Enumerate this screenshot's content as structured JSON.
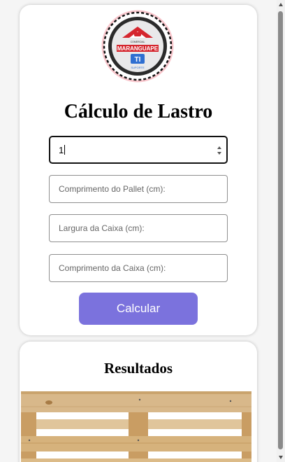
{
  "logo": {
    "top_text": "COMERCIAL",
    "brand": "MARANGUAPE",
    "sub_text": "SUPORTE",
    "colors": {
      "ring": "#222222",
      "red": "#d5262e",
      "blue": "#2f6fd1",
      "glow": "#f05a6a"
    }
  },
  "form": {
    "title": "Cálculo de Lastro",
    "quantity_value": "1",
    "pallet_length_placeholder": "Comprimento do Pallet (cm):",
    "box_width_placeholder": "Largura da Caixa (cm):",
    "box_length_placeholder": "Comprimento da Caixa (cm):",
    "submit_label": "Calcular"
  },
  "results": {
    "title": "Resultados",
    "image": "wooden-pallet"
  },
  "theme": {
    "accent": "#7b72dd",
    "card_bg": "#ffffff",
    "page_bg": "#f5f5f5"
  }
}
